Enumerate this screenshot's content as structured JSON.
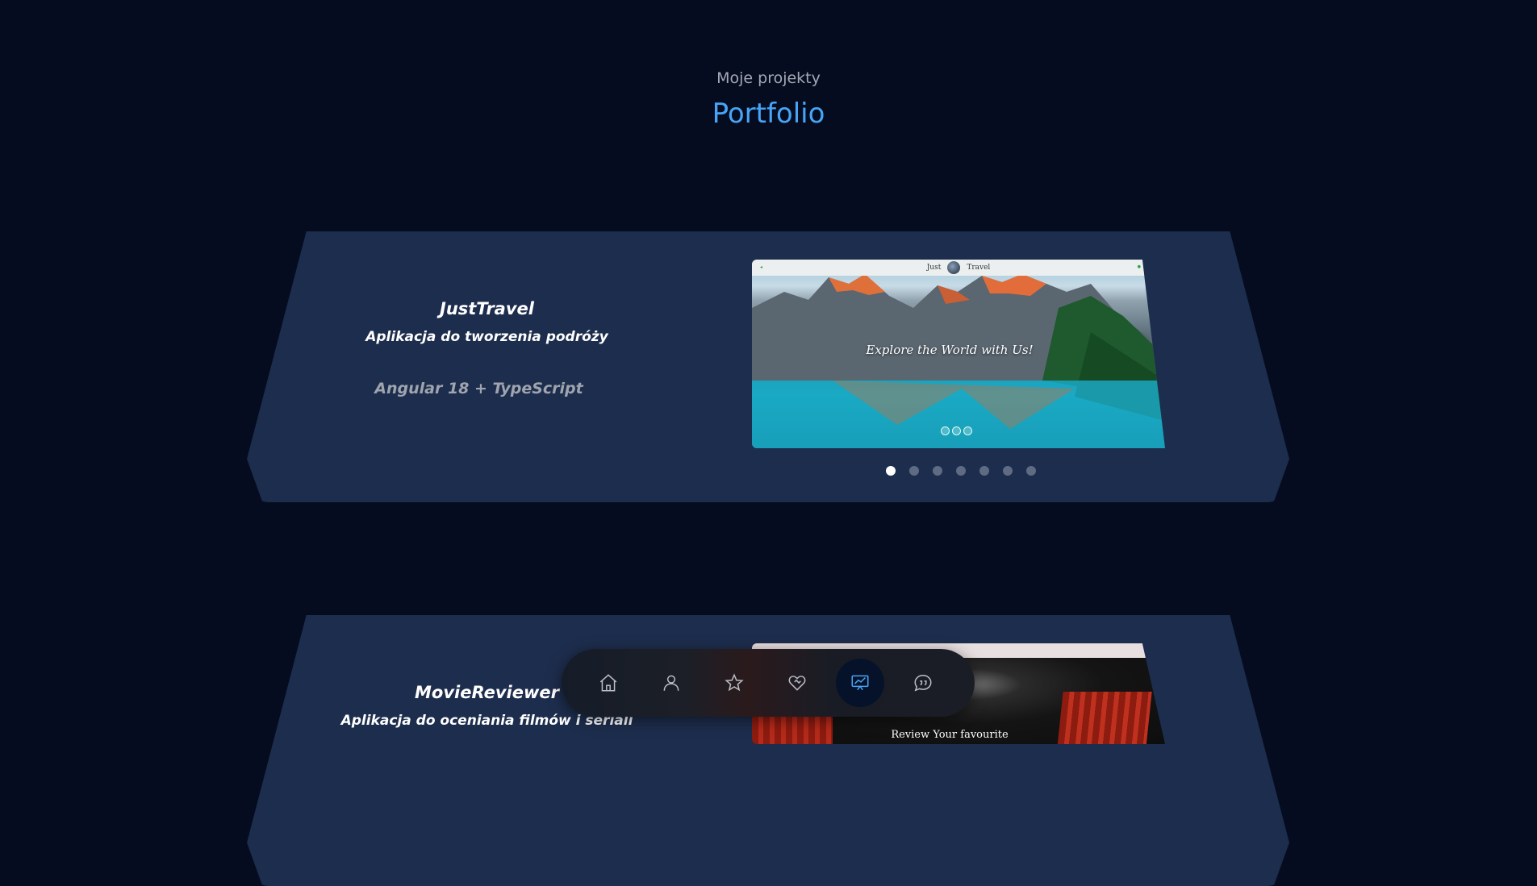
{
  "section": {
    "subtitle": "Moje projekty",
    "title": "Portfolio"
  },
  "projects": [
    {
      "name": "JustTravel",
      "description": "Aplikacja do tworzenia podróży",
      "tech": "Angular 18 + TypeScript",
      "screenshot": {
        "brand_left": "Just",
        "brand_right": "Travel",
        "caption": "Explore the World with Us!"
      },
      "carousel": {
        "count": 7,
        "active": 0
      }
    },
    {
      "name": "MovieReviewer",
      "description": "Aplikacja do oceniania filmów i seriali",
      "screenshot": {
        "caption": "Review Your favourite"
      }
    }
  ],
  "nav": {
    "items": [
      {
        "icon": "home-icon",
        "active": false
      },
      {
        "icon": "user-icon",
        "active": false
      },
      {
        "icon": "star-icon",
        "active": false
      },
      {
        "icon": "heart-handshake-icon",
        "active": false
      },
      {
        "icon": "presentation-chart-icon",
        "active": true
      },
      {
        "icon": "quote-bubble-icon",
        "active": false
      }
    ]
  },
  "colors": {
    "background": "#050c1f",
    "card": "#1d2d4d",
    "accent": "#47a4f6"
  }
}
